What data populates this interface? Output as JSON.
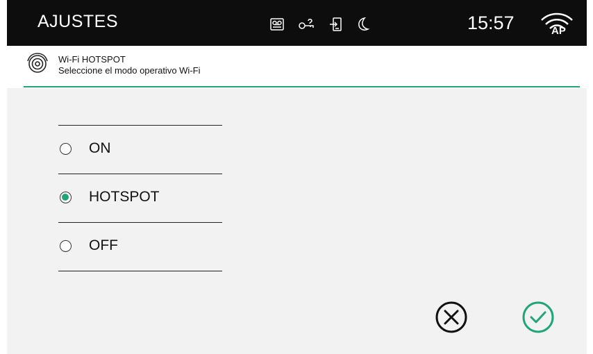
{
  "topbar": {
    "title": "AJUSTES",
    "clock": "15:57",
    "status_icons": [
      "answering-machine-icon",
      "key-icon",
      "door-entry-icon",
      "moon-icon"
    ],
    "wifi_badge": "AP"
  },
  "header": {
    "title": "Wi-Fi HOTSPOT",
    "description": "Seleccione el modo operativo Wi-Fi"
  },
  "options": [
    {
      "label": "ON",
      "selected": false
    },
    {
      "label": "HOTSPOT",
      "selected": true
    },
    {
      "label": "OFF",
      "selected": false
    }
  ],
  "actions": {
    "cancel_icon": "cancel-circle-icon",
    "confirm_icon": "confirm-check-icon"
  },
  "colors": {
    "accent": "#1fa576",
    "topbar_bg": "#0d0d0d",
    "content_bg": "#f2f2f2"
  }
}
